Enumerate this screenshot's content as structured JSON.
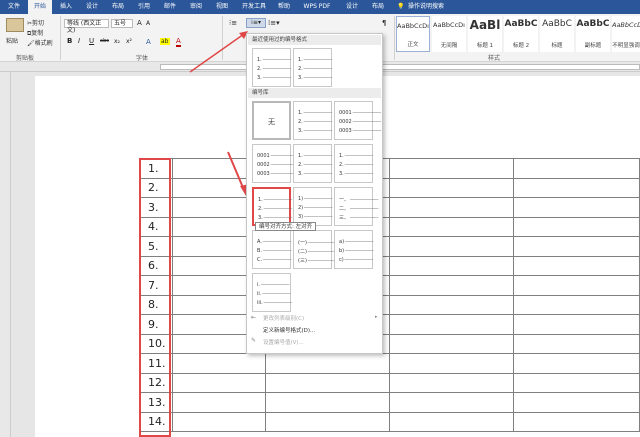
{
  "tabs": [
    "文件",
    "开始",
    "插入",
    "设计",
    "布局",
    "引用",
    "邮件",
    "审阅",
    "视图",
    "开发工具",
    "帮助",
    "WPS PDF",
    "设计",
    "布局"
  ],
  "tell_me": "操作说明搜索",
  "clipboard": {
    "paste": "粘贴",
    "cut": "剪切",
    "copy": "复制",
    "format_painter": "格式刷",
    "label": "剪贴板"
  },
  "font": {
    "name": "等线 (西文正文)",
    "size": "五号",
    "grow": "A",
    "shrink": "A",
    "label": "字体",
    "bold": "B",
    "italic": "I",
    "underline": "U",
    "strike": "abc",
    "sub": "x₂",
    "sup": "x²"
  },
  "paragraph": {
    "label": "段落"
  },
  "styles": {
    "label": "样式",
    "items": [
      {
        "sample": "AaBbCcDı",
        "name": "正文"
      },
      {
        "sample": "AaBbCcDı",
        "name": "无间隔"
      },
      {
        "sample": "AaBl",
        "name": "标题 1"
      },
      {
        "sample": "AaBbC",
        "name": "标题 2"
      },
      {
        "sample": "AaBbC",
        "name": "标题"
      },
      {
        "sample": "AaBbC",
        "name": "副标题"
      },
      {
        "sample": "AaBbCcDı",
        "name": "不明显强调"
      }
    ]
  },
  "table_numbers": [
    "1.",
    "2.",
    "3.",
    "4.",
    "5.",
    "6.",
    "7.",
    "8.",
    "9.",
    "10.",
    "11.",
    "12.",
    "13.",
    "14."
  ],
  "dropdown": {
    "recent_header": "最近使用过的编号格式",
    "library_header": "编号库",
    "none_label": "无",
    "tooltip": "编号对齐方式: 左对齐",
    "recent": [
      [
        "1.",
        "2.",
        "3."
      ],
      [
        "1.",
        "2.",
        "3."
      ]
    ],
    "library": [
      [
        "1.",
        "2.",
        "3."
      ],
      [
        "0001",
        "0002",
        "0003"
      ],
      [
        "0001",
        "0002",
        "0003"
      ],
      [
        "1.",
        "2.",
        "3."
      ],
      [
        "1.",
        "2.",
        "3."
      ],
      [
        "1.",
        "2.",
        "3."
      ],
      [
        "1)",
        "2)",
        "3)"
      ],
      [
        "一、",
        "二、",
        "三、"
      ],
      [
        "A.",
        "B.",
        "C."
      ],
      [
        "(一)",
        "(二)",
        "(三)"
      ],
      [
        "a)",
        "b)",
        "c)"
      ],
      [
        "i.",
        "ii.",
        "iii."
      ]
    ],
    "menu": [
      "更改列表级别(C)",
      "定义新编号格式(D)...",
      "设置编号值(V)..."
    ]
  }
}
